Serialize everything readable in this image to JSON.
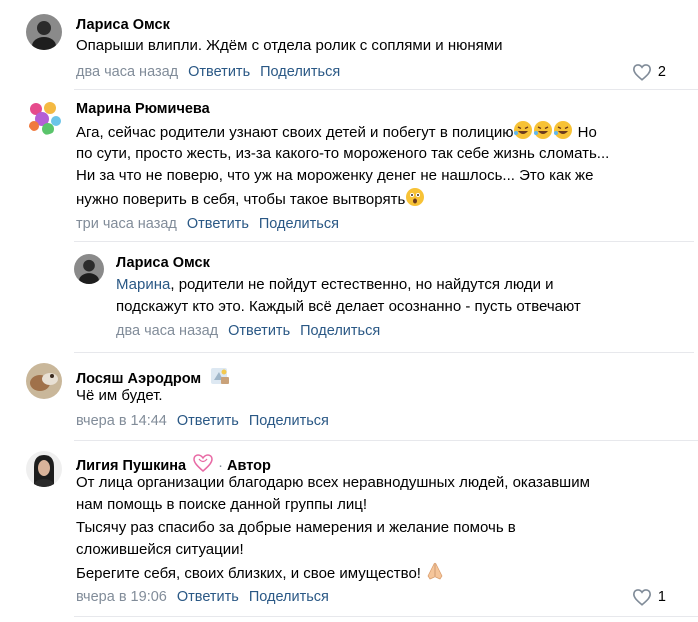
{
  "actions": {
    "reply": "Ответить",
    "share": "Поделиться"
  },
  "comments": [
    {
      "author": "Лариса Омск",
      "lines": [
        "Опарыши влипли. Ждём с отдела ролик с соплями и нюнями"
      ],
      "date": "два часа назад",
      "likes": "2"
    },
    {
      "author": "Марина Рюмичева",
      "lines": [
        "Ага, сейчас родители узнают своих детей и побегут в полицию",
        "Но",
        "по сути, просто жесть, из-за какого-то мороженого так себе жизнь сломать...",
        "Ни за что не поверю, что уж на мороженку денег не нашлось... Это как же",
        "нужно поверить в себя, чтобы такое вытворять"
      ],
      "date": "три часа назад"
    },
    {
      "author": "Лариса Омск",
      "mention": "Марина",
      "lines": [
        ", родители не пойдут естественно, но найдутся люди и",
        "подскажут кто это. Каждый всё делает осознанно - пусть отвечают"
      ],
      "date": "два часа назад"
    },
    {
      "author": "Лосяш Аэродром",
      "lines": [
        "Чё им будет."
      ],
      "date": "вчера в 14:44"
    },
    {
      "author": "Лигия Пушкина",
      "badge_sep": "·",
      "badge": "Автор",
      "lines": [
        "От лица организации благодарю всех неравнодушных людей, оказавшим",
        "нам помощь в поиске данной группы лиц!",
        "Тысячу раз спасибо за добрые намерения и желание помочь в",
        "сложившейся ситуации!",
        "Берегите себя, своих близких, и свое имущество!"
      ],
      "date": "вчера в 19:06",
      "likes": "1"
    }
  ],
  "colors": {
    "link": "#2a5885",
    "secondary": "#818c99",
    "divider": "#e7e8ec"
  }
}
